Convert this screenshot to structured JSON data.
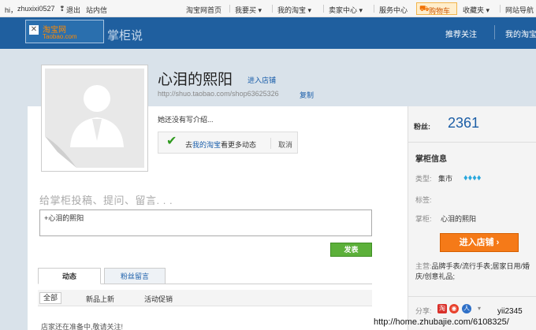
{
  "topbar": {
    "greeting": "hi，",
    "username": "zhuxixi0527",
    "logout": "退出",
    "messages": "站内信",
    "items": [
      "淘宝网首页",
      "我要买",
      "我的淘宝",
      "卖家中心",
      "服务中心"
    ],
    "cart": "购物车",
    "favorites": "收藏夹",
    "sitenav": "网站导航"
  },
  "header": {
    "logo_line1": "淘宝网",
    "logo_line2": "Taobao.com",
    "brand": "掌柜说",
    "nav_follow": "推荐关注",
    "nav_mine": "我的淘宝"
  },
  "shop": {
    "name": "心泪的熙阳",
    "enter_link": "进入店铺",
    "url": "http://shuo.taobao.com/shop63625326",
    "copy": "复制",
    "intro": "她还没有写介绍...",
    "tip_prefix": "去",
    "tip_link": "我的淘宝",
    "tip_suffix": "看更多动态",
    "tip_cancel": "取消"
  },
  "post": {
    "prompt": "给掌柜投稿、提问、留言. . .",
    "value": "+心泪的熙阳",
    "send": "发表"
  },
  "tabs": {
    "active": "动态",
    "other": "粉丝留言"
  },
  "filters": [
    "全部",
    "新品上新",
    "活动促销"
  ],
  "notice": "店家还在准备中,敬请关注!",
  "sidebar": {
    "fans_label": "粉丝:",
    "fans_count": "2361",
    "section_title": "掌柜信息",
    "type_label": "类型:",
    "type_value": "集市",
    "tags_label": "标签:",
    "owner_label": "掌柜:",
    "owner_value": "心泪的熙阳",
    "enter_button": "进入店铺 ›",
    "main_label": "主营:",
    "main_value": "品牌手表/流行手表;居家日用/婚庆/创意礼品;",
    "share_label": "分享:"
  },
  "watermark": {
    "line1": "yii2345",
    "line2": "http://home.zhubajie.com/6108325/"
  },
  "colors": {
    "header": "#1f5f9f",
    "link": "#1a5eaa",
    "send_button": "#5cb03a",
    "enter_button": "#f57a18",
    "fans_count": "#1c5ea6"
  }
}
